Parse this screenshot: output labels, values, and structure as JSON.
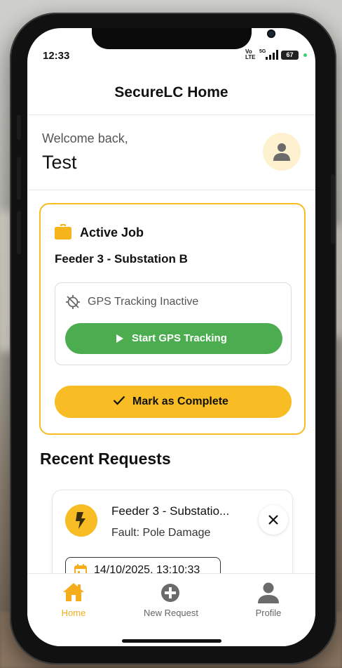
{
  "status_bar": {
    "time": "12:33",
    "network": "Vo LTE",
    "network_line1": "Vo",
    "network_line2": "LTE",
    "signal_label": "5G",
    "battery": "67"
  },
  "header": {
    "title": "SecureLC Home"
  },
  "welcome": {
    "greeting": "Welcome back,",
    "name": "Test"
  },
  "active_job": {
    "heading": "Active Job",
    "title": "Feeder 3 - Substation B",
    "gps_status": "GPS Tracking Inactive",
    "gps_button": "Start GPS Tracking",
    "complete_button": "Mark as Complete"
  },
  "recent": {
    "title": "Recent Requests",
    "items": [
      {
        "title": "Feeder 3 - Substatio...",
        "subtitle": "Fault: Pole Damage",
        "date": "14/10/2025, 13:10:33"
      }
    ]
  },
  "tabs": [
    {
      "label": "Home",
      "icon": "home-icon",
      "active": true
    },
    {
      "label": "New Request",
      "icon": "plus-circle-icon",
      "active": false
    },
    {
      "label": "Profile",
      "icon": "person-icon",
      "active": false
    }
  ],
  "colors": {
    "accent": "#f8bd24",
    "green": "#4cad50",
    "tab_active": "#f5ad1c"
  }
}
